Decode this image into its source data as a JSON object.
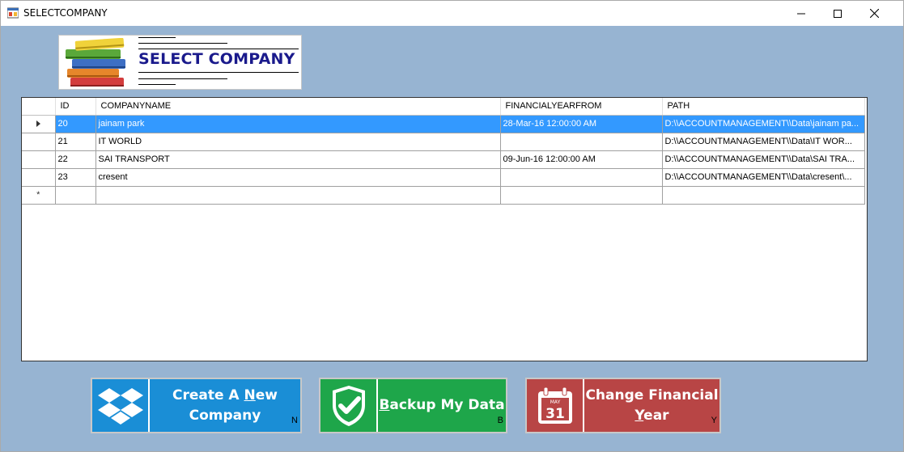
{
  "window": {
    "title": "SELECTCOMPANY",
    "icon": "app-window-icon"
  },
  "banner": {
    "title": "SELECT COMPANY",
    "icon": "books-stack-icon"
  },
  "grid": {
    "columns": [
      "ID",
      "COMPANYNAME",
      "FINANCIALYEARFROM",
      "PATH"
    ],
    "rows": [
      {
        "id": "20",
        "company": "jainam park",
        "fy_from": "28-Mar-16 12:00:00 AM",
        "path": "D:\\\\ACCOUNTMANAGEMENT\\\\Data\\jainam pa..."
      },
      {
        "id": "21",
        "company": "IT WORLD",
        "fy_from": "",
        "path": "D:\\\\ACCOUNTMANAGEMENT\\\\Data\\IT WOR..."
      },
      {
        "id": "22",
        "company": "SAI TRANSPORT",
        "fy_from": "09-Jun-16 12:00:00 AM",
        "path": "D:\\\\ACCOUNTMANAGEMENT\\\\Data\\SAI TRA..."
      },
      {
        "id": "23",
        "company": "cresent",
        "fy_from": "",
        "path": "D:\\\\ACCOUNTMANAGEMENT\\\\Data\\cresent\\..."
      }
    ],
    "new_row_marker": "*",
    "selected_row": 0
  },
  "buttons": {
    "create": {
      "line1_pre": "Create A ",
      "line1_ul": "N",
      "line1_post": "ew",
      "line2": "Company",
      "hotkey": "N",
      "icon": "dropbox-icon",
      "color": "#1a8ed6"
    },
    "backup": {
      "ul": "B",
      "rest": "ackup My Data",
      "hotkey": "B",
      "icon": "shield-check-icon",
      "color": "#1ea64a"
    },
    "year": {
      "line1": "Change Financial",
      "line2_ul": "Y",
      "line2_rest": "ear",
      "hotkey": "Y",
      "icon": "calendar-icon",
      "calendar_month": "MAY",
      "calendar_day": "31",
      "color": "#b84545"
    }
  }
}
